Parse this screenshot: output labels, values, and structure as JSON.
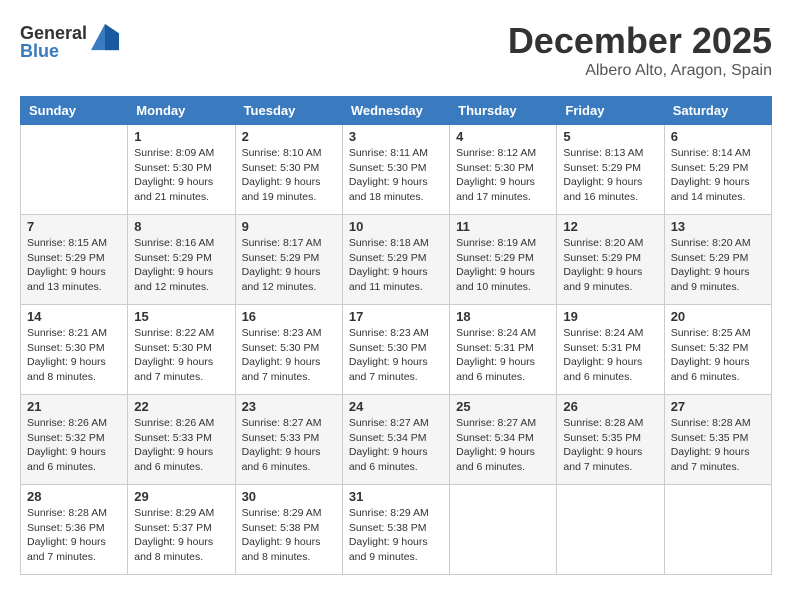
{
  "logo": {
    "general": "General",
    "blue": "Blue"
  },
  "title": "December 2025",
  "location": "Albero Alto, Aragon, Spain",
  "weekdays": [
    "Sunday",
    "Monday",
    "Tuesday",
    "Wednesday",
    "Thursday",
    "Friday",
    "Saturday"
  ],
  "weeks": [
    [
      {
        "day": "",
        "sunrise": "",
        "sunset": "",
        "daylight": ""
      },
      {
        "day": "1",
        "sunrise": "Sunrise: 8:09 AM",
        "sunset": "Sunset: 5:30 PM",
        "daylight": "Daylight: 9 hours and 21 minutes."
      },
      {
        "day": "2",
        "sunrise": "Sunrise: 8:10 AM",
        "sunset": "Sunset: 5:30 PM",
        "daylight": "Daylight: 9 hours and 19 minutes."
      },
      {
        "day": "3",
        "sunrise": "Sunrise: 8:11 AM",
        "sunset": "Sunset: 5:30 PM",
        "daylight": "Daylight: 9 hours and 18 minutes."
      },
      {
        "day": "4",
        "sunrise": "Sunrise: 8:12 AM",
        "sunset": "Sunset: 5:30 PM",
        "daylight": "Daylight: 9 hours and 17 minutes."
      },
      {
        "day": "5",
        "sunrise": "Sunrise: 8:13 AM",
        "sunset": "Sunset: 5:29 PM",
        "daylight": "Daylight: 9 hours and 16 minutes."
      },
      {
        "day": "6",
        "sunrise": "Sunrise: 8:14 AM",
        "sunset": "Sunset: 5:29 PM",
        "daylight": "Daylight: 9 hours and 14 minutes."
      }
    ],
    [
      {
        "day": "7",
        "sunrise": "Sunrise: 8:15 AM",
        "sunset": "Sunset: 5:29 PM",
        "daylight": "Daylight: 9 hours and 13 minutes."
      },
      {
        "day": "8",
        "sunrise": "Sunrise: 8:16 AM",
        "sunset": "Sunset: 5:29 PM",
        "daylight": "Daylight: 9 hours and 12 minutes."
      },
      {
        "day": "9",
        "sunrise": "Sunrise: 8:17 AM",
        "sunset": "Sunset: 5:29 PM",
        "daylight": "Daylight: 9 hours and 12 minutes."
      },
      {
        "day": "10",
        "sunrise": "Sunrise: 8:18 AM",
        "sunset": "Sunset: 5:29 PM",
        "daylight": "Daylight: 9 hours and 11 minutes."
      },
      {
        "day": "11",
        "sunrise": "Sunrise: 8:19 AM",
        "sunset": "Sunset: 5:29 PM",
        "daylight": "Daylight: 9 hours and 10 minutes."
      },
      {
        "day": "12",
        "sunrise": "Sunrise: 8:20 AM",
        "sunset": "Sunset: 5:29 PM",
        "daylight": "Daylight: 9 hours and 9 minutes."
      },
      {
        "day": "13",
        "sunrise": "Sunrise: 8:20 AM",
        "sunset": "Sunset: 5:29 PM",
        "daylight": "Daylight: 9 hours and 9 minutes."
      }
    ],
    [
      {
        "day": "14",
        "sunrise": "Sunrise: 8:21 AM",
        "sunset": "Sunset: 5:30 PM",
        "daylight": "Daylight: 9 hours and 8 minutes."
      },
      {
        "day": "15",
        "sunrise": "Sunrise: 8:22 AM",
        "sunset": "Sunset: 5:30 PM",
        "daylight": "Daylight: 9 hours and 7 minutes."
      },
      {
        "day": "16",
        "sunrise": "Sunrise: 8:23 AM",
        "sunset": "Sunset: 5:30 PM",
        "daylight": "Daylight: 9 hours and 7 minutes."
      },
      {
        "day": "17",
        "sunrise": "Sunrise: 8:23 AM",
        "sunset": "Sunset: 5:30 PM",
        "daylight": "Daylight: 9 hours and 7 minutes."
      },
      {
        "day": "18",
        "sunrise": "Sunrise: 8:24 AM",
        "sunset": "Sunset: 5:31 PM",
        "daylight": "Daylight: 9 hours and 6 minutes."
      },
      {
        "day": "19",
        "sunrise": "Sunrise: 8:24 AM",
        "sunset": "Sunset: 5:31 PM",
        "daylight": "Daylight: 9 hours and 6 minutes."
      },
      {
        "day": "20",
        "sunrise": "Sunrise: 8:25 AM",
        "sunset": "Sunset: 5:32 PM",
        "daylight": "Daylight: 9 hours and 6 minutes."
      }
    ],
    [
      {
        "day": "21",
        "sunrise": "Sunrise: 8:26 AM",
        "sunset": "Sunset: 5:32 PM",
        "daylight": "Daylight: 9 hours and 6 minutes."
      },
      {
        "day": "22",
        "sunrise": "Sunrise: 8:26 AM",
        "sunset": "Sunset: 5:33 PM",
        "daylight": "Daylight: 9 hours and 6 minutes."
      },
      {
        "day": "23",
        "sunrise": "Sunrise: 8:27 AM",
        "sunset": "Sunset: 5:33 PM",
        "daylight": "Daylight: 9 hours and 6 minutes."
      },
      {
        "day": "24",
        "sunrise": "Sunrise: 8:27 AM",
        "sunset": "Sunset: 5:34 PM",
        "daylight": "Daylight: 9 hours and 6 minutes."
      },
      {
        "day": "25",
        "sunrise": "Sunrise: 8:27 AM",
        "sunset": "Sunset: 5:34 PM",
        "daylight": "Daylight: 9 hours and 6 minutes."
      },
      {
        "day": "26",
        "sunrise": "Sunrise: 8:28 AM",
        "sunset": "Sunset: 5:35 PM",
        "daylight": "Daylight: 9 hours and 7 minutes."
      },
      {
        "day": "27",
        "sunrise": "Sunrise: 8:28 AM",
        "sunset": "Sunset: 5:35 PM",
        "daylight": "Daylight: 9 hours and 7 minutes."
      }
    ],
    [
      {
        "day": "28",
        "sunrise": "Sunrise: 8:28 AM",
        "sunset": "Sunset: 5:36 PM",
        "daylight": "Daylight: 9 hours and 7 minutes."
      },
      {
        "day": "29",
        "sunrise": "Sunrise: 8:29 AM",
        "sunset": "Sunset: 5:37 PM",
        "daylight": "Daylight: 9 hours and 8 minutes."
      },
      {
        "day": "30",
        "sunrise": "Sunrise: 8:29 AM",
        "sunset": "Sunset: 5:38 PM",
        "daylight": "Daylight: 9 hours and 8 minutes."
      },
      {
        "day": "31",
        "sunrise": "Sunrise: 8:29 AM",
        "sunset": "Sunset: 5:38 PM",
        "daylight": "Daylight: 9 hours and 9 minutes."
      },
      {
        "day": "",
        "sunrise": "",
        "sunset": "",
        "daylight": ""
      },
      {
        "day": "",
        "sunrise": "",
        "sunset": "",
        "daylight": ""
      },
      {
        "day": "",
        "sunrise": "",
        "sunset": "",
        "daylight": ""
      }
    ]
  ]
}
